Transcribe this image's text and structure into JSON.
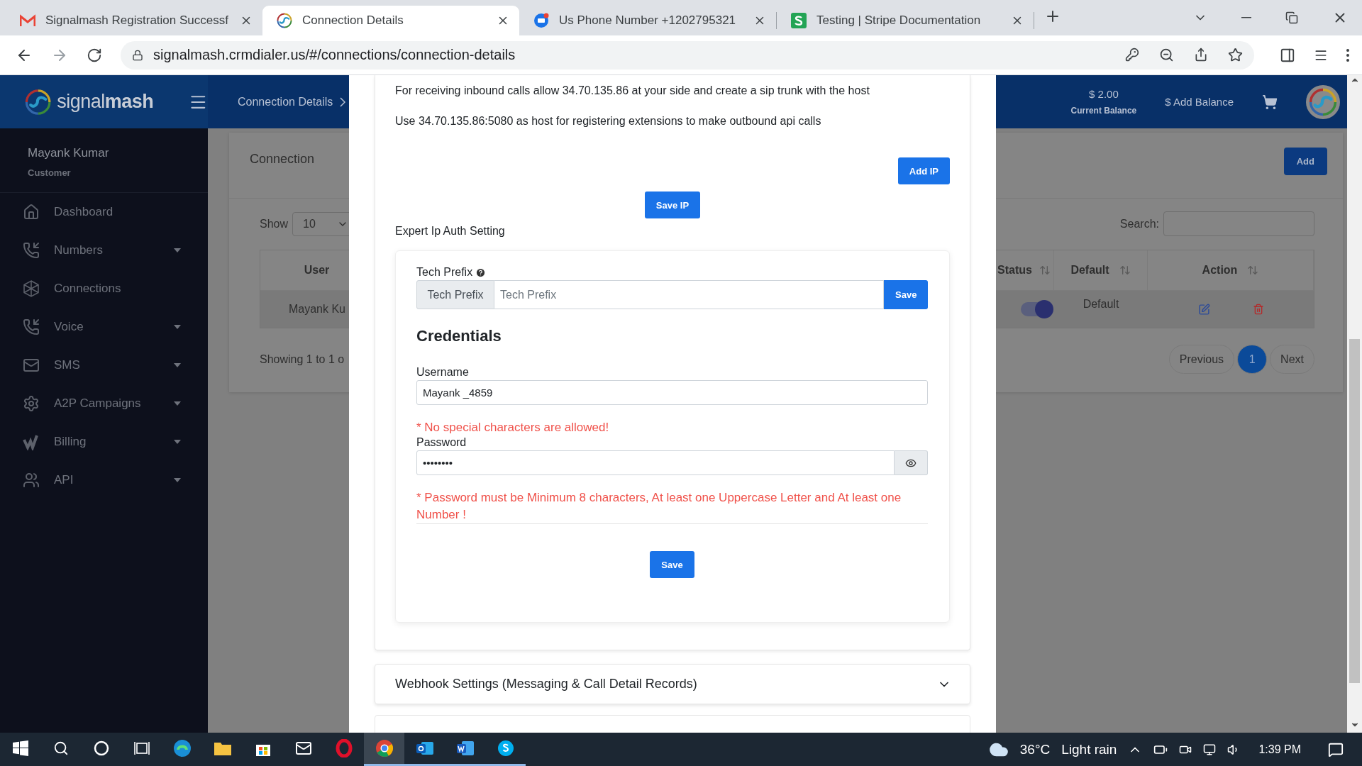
{
  "browser": {
    "tabs": [
      {
        "kind": "gmail",
        "title": "Signalmash Registration Successf",
        "selected": false
      },
      {
        "kind": "signalmash",
        "title": "Connection Details",
        "selected": true
      },
      {
        "kind": "chat",
        "title": "Us Phone Number +1202795321",
        "selected": false
      },
      {
        "kind": "stripe",
        "title": "Testing | Stripe Documentation",
        "selected": false
      }
    ],
    "url": "signalmash.crmdialer.us/#/connections/connection-details"
  },
  "header": {
    "brand": "signal**mash**",
    "breadcrumb": "Connection Details",
    "balance": "$ 2.00",
    "balance_label": "Current Balance",
    "add_balance": "$ Add Balance"
  },
  "sidebar": {
    "user": "Mayank Kumar",
    "role": "Customer",
    "items": [
      {
        "kind": "home",
        "label": "Dashboard",
        "expandable": false
      },
      {
        "kind": "phone",
        "label": "Numbers",
        "expandable": true
      },
      {
        "kind": "hexagon",
        "label": "Connections",
        "expandable": false
      },
      {
        "kind": "phone",
        "label": "Voice",
        "expandable": true
      },
      {
        "kind": "mail",
        "label": "SMS",
        "expandable": true
      },
      {
        "kind": "gear",
        "label": "A2P Campaigns",
        "expandable": true
      },
      {
        "kind": "billing",
        "label": "Billing",
        "expandable": true
      },
      {
        "kind": "users",
        "label": "API",
        "expandable": true
      }
    ]
  },
  "page": {
    "title": "Connection",
    "add": "Add",
    "show_label": "Show",
    "show_value": "10",
    "search_label": "Search:",
    "columns": [
      {
        "label": "User",
        "sortable": false
      },
      {
        "label": "Status",
        "sortable": true
      },
      {
        "label": "Default",
        "sortable": true
      },
      {
        "label": "Action",
        "sortable": true
      }
    ],
    "rows": [
      {
        "user": "Mayank Ku",
        "status_on": true,
        "default": "Default"
      }
    ],
    "info": "Showing 1 to 1 o",
    "pagination": {
      "previous": "Previous",
      "pages": [
        {
          "label": "1",
          "selected": true
        }
      ],
      "next": "Next"
    }
  },
  "modal": {
    "notes": [
      "For receiving inbound calls allow 34.70.135.86 at your side and create a sip trunk with the host",
      "Use 34.70.135.86:5080 as host for registering extensions to make outbound api calls"
    ],
    "add_ip": "Add IP",
    "save_ip": "Save IP",
    "section_title": "Expert Ip Auth Setting",
    "tech_prefix": {
      "label": "Tech Prefix",
      "addon": "Tech Prefix",
      "placeholder": "Tech Prefix",
      "button": "Save"
    },
    "credentials_title": "Credentials",
    "username": {
      "label": "Username",
      "value": "Mayank _4859",
      "error": "* No special characters are allowed!"
    },
    "password": {
      "label": "Password",
      "value": "••••••••",
      "error": "* Password must be Minimum 8 characters, At least one Uppercase Letter and At least one Number !"
    },
    "save": "Save",
    "accordion": {
      "title": "Webhook Settings (Messaging & Call Detail Records)",
      "expanded": false
    }
  },
  "taskbar": {
    "apps": [
      {
        "kind": "edge",
        "running": false,
        "selected": false
      },
      {
        "kind": "explorer",
        "running": false,
        "selected": false
      },
      {
        "kind": "store",
        "running": false,
        "selected": false
      },
      {
        "kind": "mail",
        "running": false,
        "selected": false
      },
      {
        "kind": "opera",
        "running": false,
        "selected": false
      },
      {
        "kind": "chrome",
        "running": true,
        "selected": true
      },
      {
        "kind": "outlook",
        "running": true,
        "selected": false
      },
      {
        "kind": "word",
        "running": true,
        "selected": false
      },
      {
        "kind": "skype",
        "running": true,
        "selected": false
      }
    ],
    "temperature": "36°C",
    "weather": "Light rain",
    "time": "1:39 PM"
  }
}
